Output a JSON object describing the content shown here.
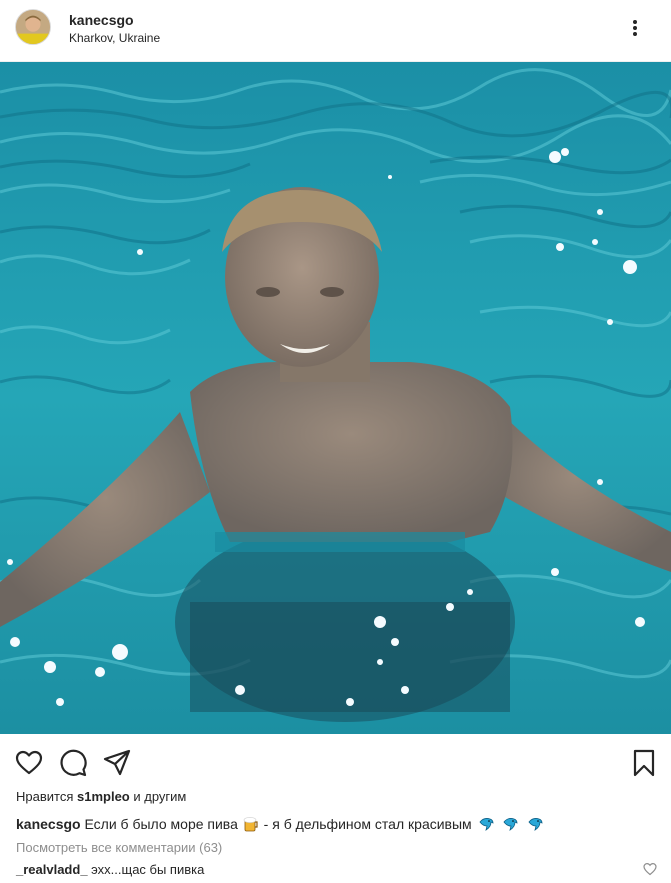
{
  "post": {
    "username": "kanecsgo",
    "location": "Kharkov, Ukraine",
    "photo_alt": "man swimming in pool"
  },
  "actions": {
    "like_icon": "heart-icon",
    "comment_icon": "comment-icon",
    "share_icon": "share-icon",
    "save_icon": "bookmark-icon"
  },
  "likes": {
    "prefix": "Нравится",
    "user": "s1mpleo",
    "suffix": "и другим"
  },
  "caption": {
    "username": "kanecsgo",
    "text_before_emoji": "Если б было море пива",
    "emoji_beer": "beer-emoji",
    "text_after_emoji": "- я б дельфином стал красивым",
    "emoji_dolphins": [
      "dolphin-emoji",
      "dolphin-emoji",
      "dolphin-emoji"
    ]
  },
  "comments": {
    "view_all": "Посмотреть все комментарии (63)",
    "items": [
      {
        "username": "_realvladd_",
        "text": "эхх...щас бы пивка"
      }
    ]
  },
  "colors": {
    "text": "#262626",
    "secondary": "#8e8e8e",
    "water": "#1fa3b3",
    "dolphin": "#2aa8d8"
  }
}
